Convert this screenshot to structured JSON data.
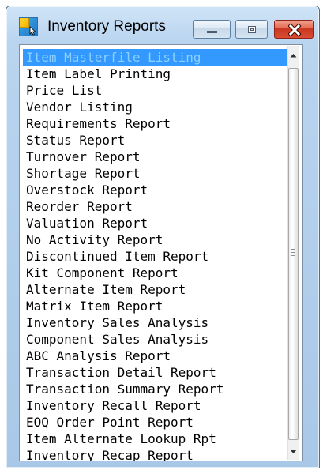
{
  "window": {
    "title": "Inventory Reports",
    "icon": "inventory-reports-icon"
  },
  "title_buttons": [
    {
      "name": "minimize-button",
      "icon": "minimize-icon"
    },
    {
      "name": "maximize-button",
      "icon": "maximize-icon"
    },
    {
      "name": "close-button",
      "icon": "close-icon"
    }
  ],
  "reports": {
    "selected_index": 0,
    "items": [
      "Item Masterfile Listing",
      "Item Label Printing",
      "Price List",
      "Vendor Listing",
      "Requirements Report",
      "Status Report",
      "Turnover Report",
      "Shortage Report",
      "Overstock Report",
      "Reorder Report",
      "Valuation Report",
      "No Activity Report",
      "Discontinued Item Report",
      "Kit Component Report",
      "Alternate Item Report",
      "Matrix Item Report",
      "Inventory Sales Analysis",
      "Component Sales Analysis",
      "ABC Analysis Report",
      "Transaction Detail Report",
      "Transaction Summary Report",
      "Inventory Recall Report",
      "EOQ Order Point Report",
      "Item Alternate Lookup Rpt",
      "Inventory Recap Report"
    ]
  },
  "colors": {
    "selection": "#3399ff",
    "selected_text": "#8bd0ff",
    "close_button": "#d84d34",
    "title_bar": "#b9d4ef"
  },
  "scrollbar": {
    "icons": [
      "scroll-up-arrow-icon",
      "scroll-down-arrow-icon",
      "scroll-grip-icon"
    ]
  }
}
